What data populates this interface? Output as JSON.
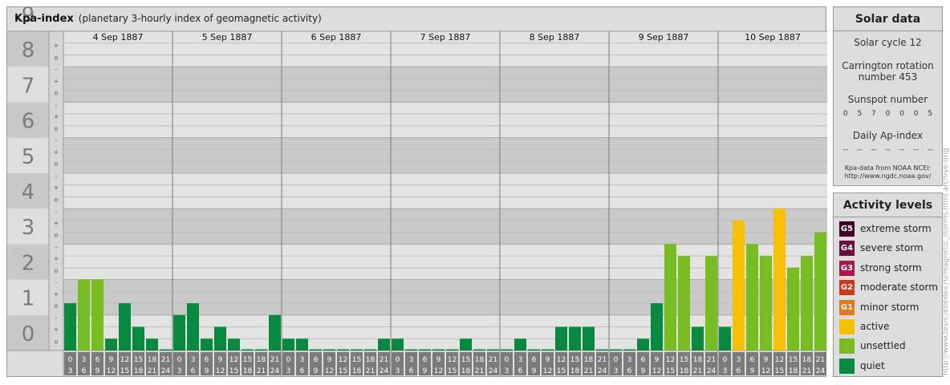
{
  "header": {
    "title": "Kpa-index",
    "subtitle": "(planetary 3-hourly index of geomagnetic activity)"
  },
  "chart_data": {
    "type": "bar",
    "title": "Kpa-index",
    "subtitle": "(planetary 3-hourly index of geomagnetic activity)",
    "xlabel": "",
    "ylabel": "",
    "ylim": [
      0,
      9
    ],
    "yticks": [
      "0",
      "1",
      "2",
      "3",
      "4",
      "5",
      "6",
      "7",
      "8",
      "9"
    ],
    "minor_tick_labels": [
      "o",
      "+",
      "-"
    ],
    "days": [
      "4 Sep 1887",
      "5 Sep 1887",
      "6 Sep 1887",
      "7 Sep 1887",
      "8 Sep 1887",
      "9 Sep 1887",
      "10 Sep 1887"
    ],
    "interval_labels": [
      {
        "top": "0",
        "bottom": "3"
      },
      {
        "top": "3",
        "bottom": "6"
      },
      {
        "top": "6",
        "bottom": "9"
      },
      {
        "top": "9",
        "bottom": "12"
      },
      {
        "top": "12",
        "bottom": "15"
      },
      {
        "top": "15",
        "bottom": "18"
      },
      {
        "top": "18",
        "bottom": "21"
      },
      {
        "top": "21",
        "bottom": "24"
      }
    ],
    "values": [
      1.333,
      2.0,
      2.0,
      0.333,
      1.333,
      0.667,
      0.333,
      0.0,
      1.0,
      1.333,
      0.333,
      0.667,
      0.333,
      0.0,
      0.0,
      1.0,
      0.333,
      0.333,
      0.0,
      0.0,
      0.0,
      0.0,
      0.0,
      0.333,
      0.333,
      0.0,
      0.0,
      0.0,
      0.0,
      0.333,
      0.0,
      0.0,
      0.0,
      0.333,
      0.0,
      0.0,
      0.667,
      0.667,
      0.667,
      0.0,
      0.0,
      0.0,
      0.333,
      1.333,
      3.0,
      2.667,
      0.667,
      2.667,
      0.667,
      3.667,
      3.0,
      2.667,
      4.0,
      2.333,
      2.667,
      3.333
    ],
    "grid": true,
    "legend": "right",
    "colors": {
      "quiet": "#078a3f",
      "unsettled": "#77bd22",
      "active": "#f7c100",
      "minor_storm": "#e07a1a",
      "moderate_storm": "#cc3a1c",
      "strong_storm": "#a8174a",
      "severe_storm": "#6b0d3f",
      "extreme_storm": "#3e0025"
    }
  },
  "solar_data": {
    "title": "Solar data",
    "solar_cycle": "Solar cycle 12",
    "carrington_line1": "Carrington rotation",
    "carrington_line2": "number 453",
    "sunspot_label": "Sunspot number",
    "sunspot_values": [
      "0",
      "5",
      "7",
      "0",
      "0",
      "0",
      "5"
    ],
    "ap_label": "Daily Ap-index",
    "ap_values": [
      "--",
      "--",
      "--",
      "--",
      "--",
      "--",
      "--"
    ],
    "source_line1": "Kpa-data from NOAA NCEI:",
    "source_line2": "http://www.ngdc.noaa.gov/"
  },
  "activity_levels": {
    "title": "Activity levels",
    "items": [
      {
        "badge": "G5",
        "label": "extreme storm",
        "color": "#3e0025"
      },
      {
        "badge": "G4",
        "label": "severe storm",
        "color": "#6b0d3f"
      },
      {
        "badge": "G3",
        "label": "strong storm",
        "color": "#a8174a"
      },
      {
        "badge": "G2",
        "label": "moderate storm",
        "color": "#cc3a1c"
      },
      {
        "badge": "G1",
        "label": "minor storm",
        "color": "#e07a1a"
      },
      {
        "badge": "",
        "label": "active",
        "color": "#f7c100"
      },
      {
        "badge": "",
        "label": "unsettled",
        "color": "#77bd22"
      },
      {
        "badge": "",
        "label": "quiet",
        "color": "#078a3f"
      }
    ]
  },
  "watermark": "http://www.tesis.lebedev.ru/magnetic_storms.html  archive-orig"
}
